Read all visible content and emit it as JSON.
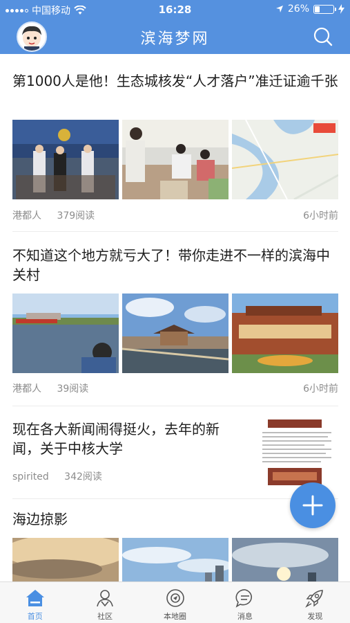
{
  "status": {
    "carrier": "中国移动",
    "time": "16:28",
    "battery_pct": "26%",
    "battery_level": 0.26
  },
  "nav": {
    "title": "滨海梦网",
    "search_icon": "search-icon",
    "avatar_icon": "user-avatar"
  },
  "articles": [
    {
      "title": "第1000人是他！生态城核发“人才落户”准迁证逾千张",
      "author": "港都人",
      "reads": "379阅读",
      "time": "6小时前"
    },
    {
      "title": "不知道这个地方就亏大了！带你走进不一样的滨海中关村",
      "author": "港都人",
      "reads": "39阅读",
      "time": "6小时前"
    },
    {
      "title": "现在各大新闻闹得挺火，去年的新闻，关于中核大学",
      "author": "spirited",
      "reads": "342阅读"
    },
    {
      "title": "海边掠影"
    }
  ],
  "fab": {
    "icon": "plus-icon"
  },
  "tabs": [
    {
      "label": "首页",
      "icon": "home-icon",
      "active": true
    },
    {
      "label": "社区",
      "icon": "community-icon",
      "active": false
    },
    {
      "label": "本地圈",
      "icon": "local-circle-icon",
      "active": false
    },
    {
      "label": "消息",
      "icon": "message-icon",
      "active": false
    },
    {
      "label": "发现",
      "icon": "rocket-icon",
      "active": false
    }
  ],
  "colors": {
    "header": "#5591df",
    "accent": "#4a8fe2",
    "meta_text": "#8c8c8c"
  }
}
